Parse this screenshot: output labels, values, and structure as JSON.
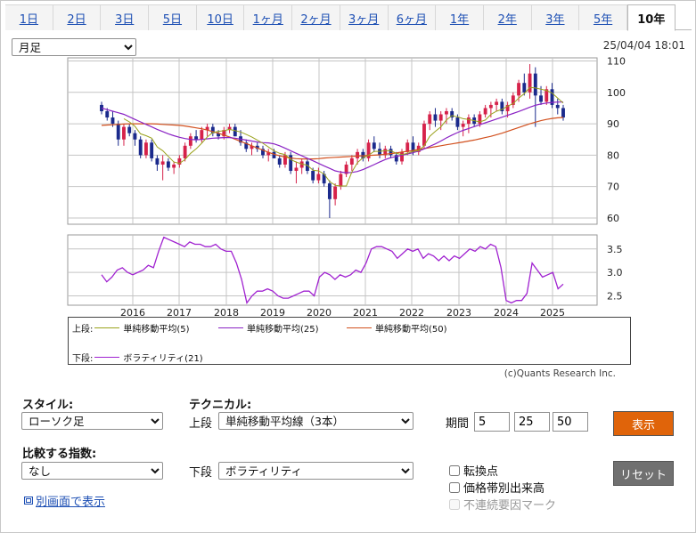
{
  "tabs": [
    "1日",
    "2日",
    "3日",
    "5日",
    "10日",
    "1ヶ月",
    "2ヶ月",
    "3ヶ月",
    "6ヶ月",
    "1年",
    "2年",
    "3年",
    "5年",
    "10年"
  ],
  "active_tab": "10年",
  "period_select": "月足",
  "timestamp": "25/04/04 18:01",
  "copyright": "(c)Quants Research Inc.",
  "legend": {
    "upper_label": "上段:",
    "lower_label": "下段:",
    "ma5": "単純移動平均(5)",
    "ma25": "単純移動平均(25)",
    "ma50": "単純移動平均(50)",
    "vol": "ボラティリティ(21)"
  },
  "controls": {
    "style_label": "スタイル:",
    "style_value": "ローソク足",
    "technical_label": "テクニカル:",
    "upper_label": "上段",
    "upper_value": "単純移動平均線（3本）",
    "period_label": "期間",
    "period_values": [
      "5",
      "25",
      "50"
    ],
    "show_button": "表示",
    "compare_label": "比較する指数:",
    "compare_value": "なし",
    "lower_label": "下段",
    "lower_value": "ボラティリティ",
    "reset_button": "リセット",
    "chk_turning": "転換点",
    "chk_volume": "価格帯別出来高",
    "chk_gap": "不連続要因マーク",
    "open_window": "別画面で表示"
  },
  "colors": {
    "up": "#d6224a",
    "down": "#1b2a8c",
    "ma5": "#9aa21c",
    "ma25": "#8a22c4",
    "ma50": "#d2501e",
    "vol": "#a022d0",
    "show_btn": "#e0640a",
    "reset_btn": "#707070"
  },
  "chart_data": {
    "type": "candlestick",
    "x_ticks": [
      "2016",
      "2017",
      "2018",
      "2019",
      "2020",
      "2021",
      "2022",
      "2023",
      "2024",
      "2025"
    ],
    "upper": {
      "ylim": [
        58,
        111
      ],
      "y_ticks": [
        60,
        70,
        80,
        90,
        100,
        110
      ],
      "ohlc": [
        [
          96,
          97,
          93,
          94
        ],
        [
          94,
          95,
          91,
          92
        ],
        [
          92,
          94,
          89,
          90
        ],
        [
          90,
          91,
          83,
          85
        ],
        [
          85,
          90,
          83,
          89
        ],
        [
          89,
          90,
          86,
          87
        ],
        [
          87,
          88,
          83,
          85
        ],
        [
          85,
          86,
          79,
          80
        ],
        [
          80,
          85,
          79,
          84
        ],
        [
          84,
          85,
          78,
          79
        ],
        [
          79,
          80,
          75,
          77
        ],
        [
          77,
          80,
          72,
          78
        ],
        [
          78,
          79,
          75,
          76
        ],
        [
          76,
          78,
          74,
          77
        ],
        [
          77,
          80,
          76,
          79
        ],
        [
          79,
          84,
          78,
          83
        ],
        [
          83,
          87,
          82,
          86
        ],
        [
          86,
          88,
          84,
          85
        ],
        [
          85,
          89,
          84,
          88
        ],
        [
          88,
          90,
          86,
          89
        ],
        [
          89,
          90,
          86,
          87
        ],
        [
          87,
          88,
          85,
          86
        ],
        [
          86,
          89,
          85,
          88
        ],
        [
          88,
          90,
          87,
          89
        ],
        [
          89,
          90,
          86,
          86
        ],
        [
          86,
          88,
          83,
          84
        ],
        [
          84,
          85,
          81,
          82
        ],
        [
          82,
          84,
          80,
          83
        ],
        [
          83,
          84,
          81,
          82
        ],
        [
          82,
          83,
          79,
          80
        ],
        [
          80,
          82,
          78,
          81
        ],
        [
          81,
          82,
          79,
          79
        ],
        [
          79,
          80,
          76,
          77
        ],
        [
          77,
          81,
          76,
          80
        ],
        [
          80,
          81,
          74,
          75
        ],
        [
          75,
          78,
          71,
          76
        ],
        [
          76,
          79,
          74,
          78
        ],
        [
          78,
          79,
          74,
          75
        ],
        [
          75,
          76,
          71,
          72
        ],
        [
          72,
          76,
          71,
          74
        ],
        [
          74,
          75,
          70,
          71
        ],
        [
          71,
          72,
          60,
          66
        ],
        [
          66,
          71,
          64,
          70
        ],
        [
          70,
          75,
          69,
          74
        ],
        [
          74,
          78,
          73,
          77
        ],
        [
          77,
          80,
          75,
          79
        ],
        [
          79,
          82,
          77,
          81
        ],
        [
          81,
          82,
          78,
          79
        ],
        [
          79,
          85,
          78,
          84
        ],
        [
          84,
          86,
          81,
          82
        ],
        [
          82,
          84,
          79,
          80
        ],
        [
          80,
          83,
          79,
          82
        ],
        [
          82,
          83,
          79,
          80
        ],
        [
          80,
          81,
          77,
          78
        ],
        [
          78,
          82,
          77,
          81
        ],
        [
          81,
          85,
          80,
          84
        ],
        [
          84,
          86,
          80,
          81
        ],
        [
          81,
          84,
          80,
          83
        ],
        [
          83,
          91,
          82,
          90
        ],
        [
          90,
          94,
          88,
          93
        ],
        [
          93,
          95,
          89,
          91
        ],
        [
          91,
          94,
          88,
          93
        ],
        [
          93,
          95,
          90,
          94
        ],
        [
          94,
          95,
          91,
          92
        ],
        [
          92,
          93,
          88,
          89
        ],
        [
          89,
          91,
          86,
          90
        ],
        [
          90,
          93,
          87,
          92
        ],
        [
          92,
          93,
          89,
          90
        ],
        [
          90,
          94,
          89,
          93
        ],
        [
          93,
          96,
          92,
          95
        ],
        [
          95,
          97,
          92,
          96
        ],
        [
          96,
          98,
          94,
          97
        ],
        [
          97,
          98,
          93,
          94
        ],
        [
          94,
          97,
          92,
          96
        ],
        [
          96,
          100,
          95,
          99
        ],
        [
          99,
          104,
          97,
          103
        ],
        [
          103,
          106,
          99,
          100
        ],
        [
          100,
          109,
          98,
          106
        ],
        [
          106,
          108,
          89,
          99
        ],
        [
          99,
          102,
          96,
          97
        ],
        [
          97,
          102,
          96,
          101
        ],
        [
          101,
          103,
          95,
          96
        ],
        [
          96,
          98,
          93,
          95
        ],
        [
          95,
          96,
          91,
          92
        ]
      ],
      "ma5": [
        null,
        null,
        null,
        null,
        91.6,
        90.6,
        89.2,
        86.8,
        86.2,
        85.4,
        82.6,
        81.4,
        79.6,
        77.8,
        77.4,
        78.6,
        80.6,
        82.0,
        83.8,
        85.8,
        87.2,
        87.6,
        87.8,
        88.2,
        87.8,
        87.4,
        86.6,
        85.8,
        84.8,
        83.8,
        82.6,
        81.4,
        80.6,
        80.2,
        78.6,
        77.8,
        77.2,
        76.8,
        75.2,
        75.0,
        74.0,
        71.6,
        70.4,
        70.2,
        70.2,
        74.6,
        77.6,
        79.2,
        80.0,
        81.2,
        81.2,
        81.4,
        81.4,
        80.6,
        80.2,
        80.6,
        81.2,
        81.4,
        83.0,
        86.0,
        87.6,
        89.0,
        91.2,
        92.6,
        92.2,
        91.6,
        91.4,
        91.0,
        90.6,
        91.2,
        93.0,
        94.0,
        94.6,
        95.6,
        96.4,
        98.2,
        99.6,
        101.6,
        101.4,
        101.0,
        100.6,
        99.8,
        98.2,
        96.6
      ],
      "ma25": [
        95,
        94.5,
        94,
        93.5,
        93,
        92.2,
        91.4,
        90.6,
        89.8,
        89,
        88.2,
        87.5,
        86.8,
        86.2,
        85.7,
        85.3,
        85,
        84.9,
        85,
        85.2,
        85.4,
        85.5,
        85.6,
        85.6,
        85.4,
        85.1,
        84.8,
        84.5,
        84.2,
        84,
        83.9,
        83.6,
        83,
        82.2,
        81.4,
        80.6,
        79.8,
        79,
        78.2,
        77.4,
        76.6,
        75.8,
        75,
        74.6,
        74.4,
        74.5,
        74.8,
        75.4,
        76.2,
        77,
        77.8,
        78.6,
        79.2,
        79.6,
        80,
        80.4,
        80.8,
        81.3,
        82,
        82.8,
        83.6,
        84.5,
        85.5,
        86.4,
        87.2,
        87.9,
        88.5,
        89.1,
        89.7,
        90.3,
        90.9,
        91.5,
        92.1,
        92.7,
        93.3,
        93.9,
        94.6,
        95.3,
        95.9,
        96.3,
        96.6,
        96.8,
        96.9,
        96.9
      ],
      "ma50": [
        89.5,
        89.6,
        89.7,
        89.8,
        89.9,
        90,
        90,
        90,
        90,
        90,
        89.9,
        89.8,
        89.7,
        89.6,
        89.5,
        89.3,
        89,
        88.7,
        88.4,
        88,
        87.5,
        87,
        86.4,
        85.8,
        85.1,
        84.4,
        83.7,
        83,
        82.3,
        81.6,
        80.9,
        80.3,
        79.8,
        79.4,
        79.1,
        78.9,
        78.8,
        78.8,
        78.8,
        78.9,
        79.1,
        79.2,
        79.3,
        79.4,
        79.5,
        79.6,
        79.7,
        79.8,
        79.9,
        80,
        80.1,
        80.3,
        80.5,
        80.7,
        81,
        81.2,
        81.5,
        81.8,
        82.1,
        82.4,
        82.7,
        83,
        83.3,
        83.6,
        83.9,
        84.2,
        84.5,
        84.8,
        85.2,
        85.6,
        86,
        86.5,
        87,
        87.6,
        88.2,
        88.8,
        89.4,
        90,
        90.5,
        91,
        91.4,
        91.7,
        91.9,
        92
      ]
    },
    "lower": {
      "ylim": [
        2.3,
        3.8
      ],
      "y_ticks": [
        2.5,
        3.0,
        3.5
      ],
      "volatility": [
        2.95,
        2.8,
        2.9,
        3.05,
        3.1,
        3.0,
        2.95,
        3.0,
        3.05,
        3.15,
        3.1,
        3.45,
        3.75,
        3.7,
        3.65,
        3.6,
        3.55,
        3.65,
        3.6,
        3.6,
        3.55,
        3.55,
        3.6,
        3.5,
        3.45,
        3.45,
        3.2,
        2.85,
        2.35,
        2.5,
        2.6,
        2.6,
        2.65,
        2.6,
        2.5,
        2.45,
        2.45,
        2.5,
        2.55,
        2.6,
        2.6,
        2.5,
        2.9,
        3.0,
        2.95,
        2.85,
        2.95,
        2.9,
        2.95,
        3.05,
        3.0,
        3.2,
        3.5,
        3.55,
        3.55,
        3.5,
        3.45,
        3.3,
        3.4,
        3.5,
        3.45,
        3.5,
        3.3,
        3.4,
        3.35,
        3.25,
        3.35,
        3.25,
        3.35,
        3.3,
        3.4,
        3.5,
        3.45,
        3.55,
        3.5,
        3.6,
        3.55,
        3.1,
        2.4,
        2.35,
        2.4,
        2.4,
        2.55,
        3.2,
        3.05,
        2.9,
        2.95,
        3.0,
        2.65,
        2.75
      ]
    }
  }
}
